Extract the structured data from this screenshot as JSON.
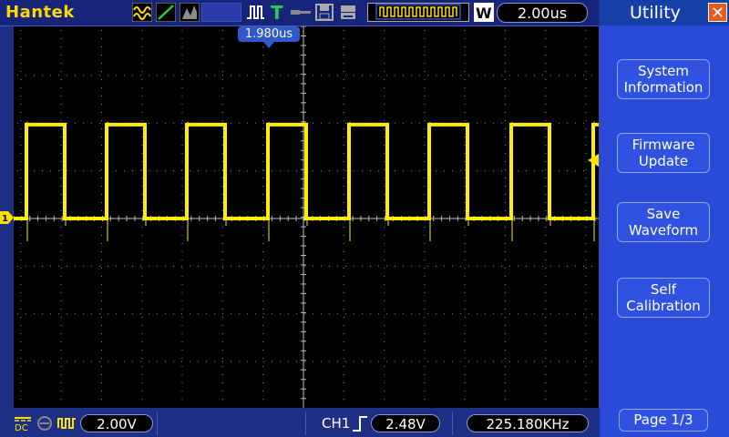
{
  "brand": "Hantek",
  "colors": {
    "trace": "#ffee00",
    "background": "#000000",
    "frame": "#1e2f86",
    "menu": "#2a4bd8",
    "grid": "#8a8a8a"
  },
  "topbar": {
    "icons": [
      "acquire-mode-icon",
      "sine-icon",
      "gray-signal-icon",
      "channel-status-blank",
      "trigger-edge-icon",
      "trigger-t-icon",
      "probe-icon",
      "save-disk-icon",
      "print-icon",
      "memory-overview-icon",
      "w-window-icon"
    ],
    "timebase": "2.00us"
  },
  "trigger_position": "1.980us",
  "bottombar": {
    "ch_coupling_icon": "dc-coupling-icon",
    "volts_div": "2.00V",
    "trigger_channel": "CH1",
    "trigger_slope_icon": "rising-edge-icon",
    "trigger_level": "2.48V",
    "frequency": "225.180KHz"
  },
  "channel_marker": "1",
  "menu": {
    "title": "Utility",
    "close_icon": "close-x-icon",
    "items": [
      {
        "line1": "System",
        "line2": "Information"
      },
      {
        "line1": "Firmware",
        "line2": "Update"
      },
      {
        "line1": "Save",
        "line2": "Waveform"
      },
      {
        "line1": "Self",
        "line2": "Calibration"
      }
    ],
    "page": "Page 1/3"
  },
  "waveform": {
    "type": "square",
    "high_div": 2.4,
    "low_div": 0.0,
    "edges_x_div": [
      0.2,
      0.65,
      1.1,
      1.55,
      2.0,
      2.45,
      2.9,
      3.3,
      4.0,
      4.45,
      5.0,
      5.45,
      6.0,
      6.45,
      7.0,
      7.45,
      8.0
    ]
  }
}
